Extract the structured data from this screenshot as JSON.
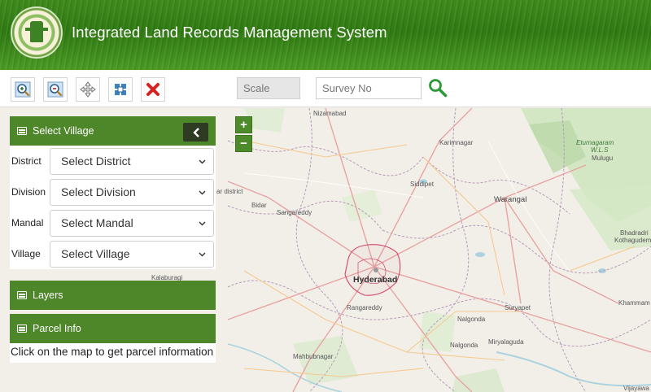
{
  "header": {
    "title": "Integrated Land Records Management System",
    "emblem_text": "GOVERNMENT OF TELANGANA"
  },
  "toolbar": {
    "tools": [
      {
        "name": "zoom-in-tool-icon"
      },
      {
        "name": "zoom-out-tool-icon"
      },
      {
        "name": "pan-tool-icon"
      },
      {
        "name": "full-extent-tool-icon"
      },
      {
        "name": "clear-tool-icon"
      }
    ],
    "scale_label": "Scale",
    "survey_placeholder": "Survey No"
  },
  "map": {
    "zoom_in": "+",
    "zoom_out": "−",
    "places": {
      "nizamabad": "Nizamabad",
      "karimnagar": "Karimnagar",
      "eturnagaram": "Eturnagaram",
      "wls": "W.L.S",
      "mulugu": "Mulugu",
      "siddipet": "Siddipet",
      "warangal": "Warangal",
      "bidar": "Bidar",
      "sangareddy": "Sangareddy",
      "bidar_district": "ar district",
      "hyderabad": "Hyderabad",
      "rangareddy": "Rangareddy",
      "kalaburagi": "Kalaburagi",
      "suryapet": "Suryapet",
      "nalgonda": "Nalgonda",
      "nalgonda2": "Nalgonda",
      "khammam": "Khammam",
      "mahbubnagar": "Mahbubnagar",
      "miryalaguda": "Miryalaguda",
      "bhadradri": "Bhadradri",
      "kothagudem": "Kothagudem",
      "vijayawada": "Vijayawa"
    }
  },
  "panel": {
    "select_village": {
      "title": "Select Village",
      "fields": [
        {
          "label": "District",
          "value": "Select District"
        },
        {
          "label": "Division",
          "value": "Select Division"
        },
        {
          "label": "Mandal",
          "value": "Select Mandal"
        },
        {
          "label": "Village",
          "value": "Select Village"
        }
      ]
    },
    "layers_title": "Layers",
    "parcel_title": "Parcel Info",
    "parcel_text": "Click on the map to get parcel information"
  },
  "colors": {
    "header_green": "#3f8a1c",
    "panel_green": "#4e862a",
    "collapse_dark": "#2f3a22",
    "boundary_red": "#d1476b"
  }
}
